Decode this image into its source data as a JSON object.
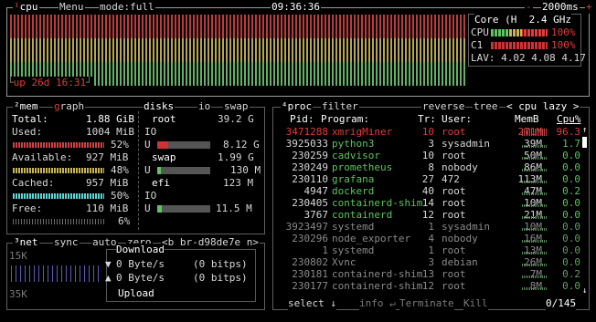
{
  "top": {
    "cpu_tab": "¹cpu",
    "menu": "Menu",
    "mode": "mode:full",
    "clock": "09:36:36",
    "minus": "-",
    "interval": "2000ms",
    "plus": "+"
  },
  "cpu": {
    "header": "Core (H  2.4 GHz",
    "rows": [
      {
        "label": "CPU",
        "pct": "100%",
        "value": 1.0
      },
      {
        "label": "C1",
        "pct": "100%",
        "value": 1.0
      }
    ],
    "lav_label": "LAV:",
    "lav": "4.02 4.08 4.17",
    "uptime": "up 26d 16:31"
  },
  "mem": {
    "tab": "²mem",
    "graph": "graph",
    "total_label": "Total:",
    "total": "1.88 GiB",
    "used_label": "Used:",
    "used": "1004 MiB",
    "used_pct": "52%",
    "used_frac": 0.52,
    "available_label": "Available:",
    "available": "927 MiB",
    "available_pct": "48%",
    "available_frac": 0.48,
    "cached_label": "Cached:",
    "cached": "957 MiB",
    "cached_pct": "50%",
    "cached_frac": 0.5,
    "free_label": "Free:",
    "free": "110 MiB",
    "free_pct": "6%",
    "free_frac": 0.06
  },
  "disks": {
    "tab": "disks",
    "io": "io",
    "swap": "swap",
    "root_label": "root",
    "root_size": "39.2 G",
    "io_label": "IO",
    "u_label": "U",
    "root_used": "8.12 G",
    "root_frac": 0.21,
    "swap_label": "swap",
    "swap_size": "1.99 G",
    "swap_used": "130 M",
    "swap_frac": 0.07,
    "efi_label": "efi",
    "efi_size": "123 M",
    "efi_used": "11.5 M",
    "efi_frac": 0.09
  },
  "net": {
    "tab": "³net",
    "sync": "sync",
    "auto": "auto",
    "zero": "zero",
    "iface": "<b br-d98de7e n>",
    "scale_top": "15K",
    "scale_bottom": "35K",
    "download": "Download",
    "down_rate": "0 Byte/s",
    "down_bits": "(0 bitps)",
    "up_rate": "0 Byte/s",
    "up_bits": "(0 bitps)",
    "upload": "Upload"
  },
  "proc": {
    "tab": "⁴proc",
    "filter": "filter",
    "reverse": "reverse",
    "tree": "tree",
    "sort": "< cpu lazy >",
    "columns": {
      "pid": "Pid:",
      "program": "Program:",
      "tr": "Tr:",
      "user": "User:",
      "mem": "MemB",
      "cpu": "Cpu%"
    },
    "rows": [
      {
        "pid": "3471288",
        "program": "xmrigMiner",
        "tr": "10",
        "user": "root",
        "mem": "271M",
        "cpu": "96.3"
      },
      {
        "pid": "3925033",
        "program": "python3",
        "tr": "3",
        "user": "sysadmin",
        "mem": "39M",
        "cpu": "1.7"
      },
      {
        "pid": "230259",
        "program": "cadvisor",
        "tr": "10",
        "user": "root",
        "mem": "50M",
        "cpu": "0.0"
      },
      {
        "pid": "230249",
        "program": "prometheus",
        "tr": "8",
        "user": "nobody",
        "mem": "86M",
        "cpu": "0.0"
      },
      {
        "pid": "230110",
        "program": "grafana",
        "tr": "27",
        "user": "472",
        "mem": "113M",
        "cpu": "0.0"
      },
      {
        "pid": "4947",
        "program": "dockerd",
        "tr": "40",
        "user": "root",
        "mem": "47M",
        "cpu": "0.2"
      },
      {
        "pid": "230405",
        "program": "containerd-shim",
        "tr": "14",
        "user": "root",
        "mem": "10M",
        "cpu": "0.0"
      },
      {
        "pid": "3767",
        "program": "containerd",
        "tr": "12",
        "user": "root",
        "mem": "21M",
        "cpu": "0.0"
      },
      {
        "pid": "3923497",
        "program": "systemd",
        "tr": "1",
        "user": "sysadmin",
        "mem": "10M",
        "cpu": "0.0"
      },
      {
        "pid": "230296",
        "program": "node_exporter",
        "tr": "4",
        "user": "nobody",
        "mem": "16M",
        "cpu": "0.0"
      },
      {
        "pid": "1",
        "program": "systemd",
        "tr": "1",
        "user": "root",
        "mem": "13M",
        "cpu": "0.0"
      },
      {
        "pid": "230802",
        "program": "Xvnc",
        "tr": "3",
        "user": "debian",
        "mem": "26M",
        "cpu": "0.0"
      },
      {
        "pid": "230181",
        "program": "containerd-shim",
        "tr": "13",
        "user": "root",
        "mem": "7M",
        "cpu": "0.2"
      },
      {
        "pid": "230177",
        "program": "containerd-shim",
        "tr": "12",
        "user": "root",
        "mem": "8M",
        "cpu": "0.0"
      }
    ],
    "select": "select ↓",
    "info": "info ↵",
    "terminate": "Terminate",
    "kill": "Kill",
    "count": "0/145"
  },
  "colors": {
    "border": "#606060",
    "accent": "#e23b3b",
    "green": "#5fc35f",
    "cyan": "#5fd7d7",
    "yellow": "#c7b55a",
    "dim": "#7a7a7a"
  }
}
